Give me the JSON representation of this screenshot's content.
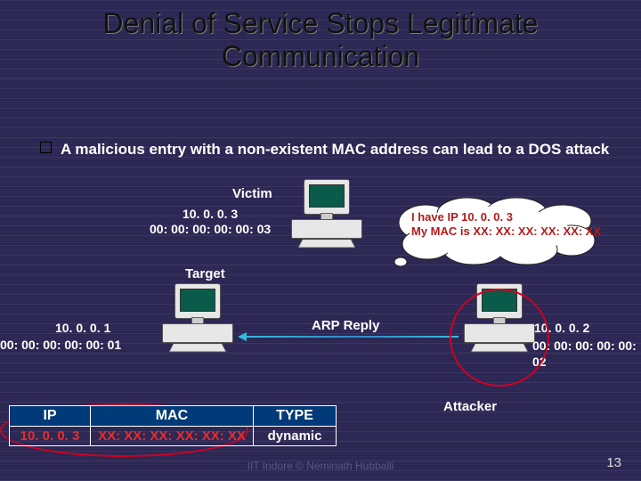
{
  "title": "Denial of Service Stops Legitimate Communication",
  "bullet": "A malicious entry with a non-existent MAC address can lead to a DOS attack",
  "victim": {
    "label": "Victim",
    "ip": "10. 0. 0. 3",
    "mac": "00: 00: 00: 00: 00: 03"
  },
  "cloud": {
    "line1": "I have IP 10. 0. 0. 3",
    "line2": "My MAC is XX: XX: XX: XX: XX: XX"
  },
  "target": {
    "label": "Target",
    "ip": "10. 0. 0. 1",
    "mac": "00: 00: 00: 00: 00: 01"
  },
  "arp_label": "ARP Reply",
  "attacker": {
    "label": "Attacker",
    "ip": "10. 0. 0. 2",
    "mac": "00: 00: 00: 00: 00: 02"
  },
  "table": {
    "headers": [
      "IP",
      "MAC",
      "TYPE"
    ],
    "row": {
      "ip": "10. 0. 0. 3",
      "mac": "XX: XX: XX: XX: XX: XX",
      "type": "dynamic"
    }
  },
  "footer": "IIT Indore  © Neminath Hubballi",
  "page": "13"
}
